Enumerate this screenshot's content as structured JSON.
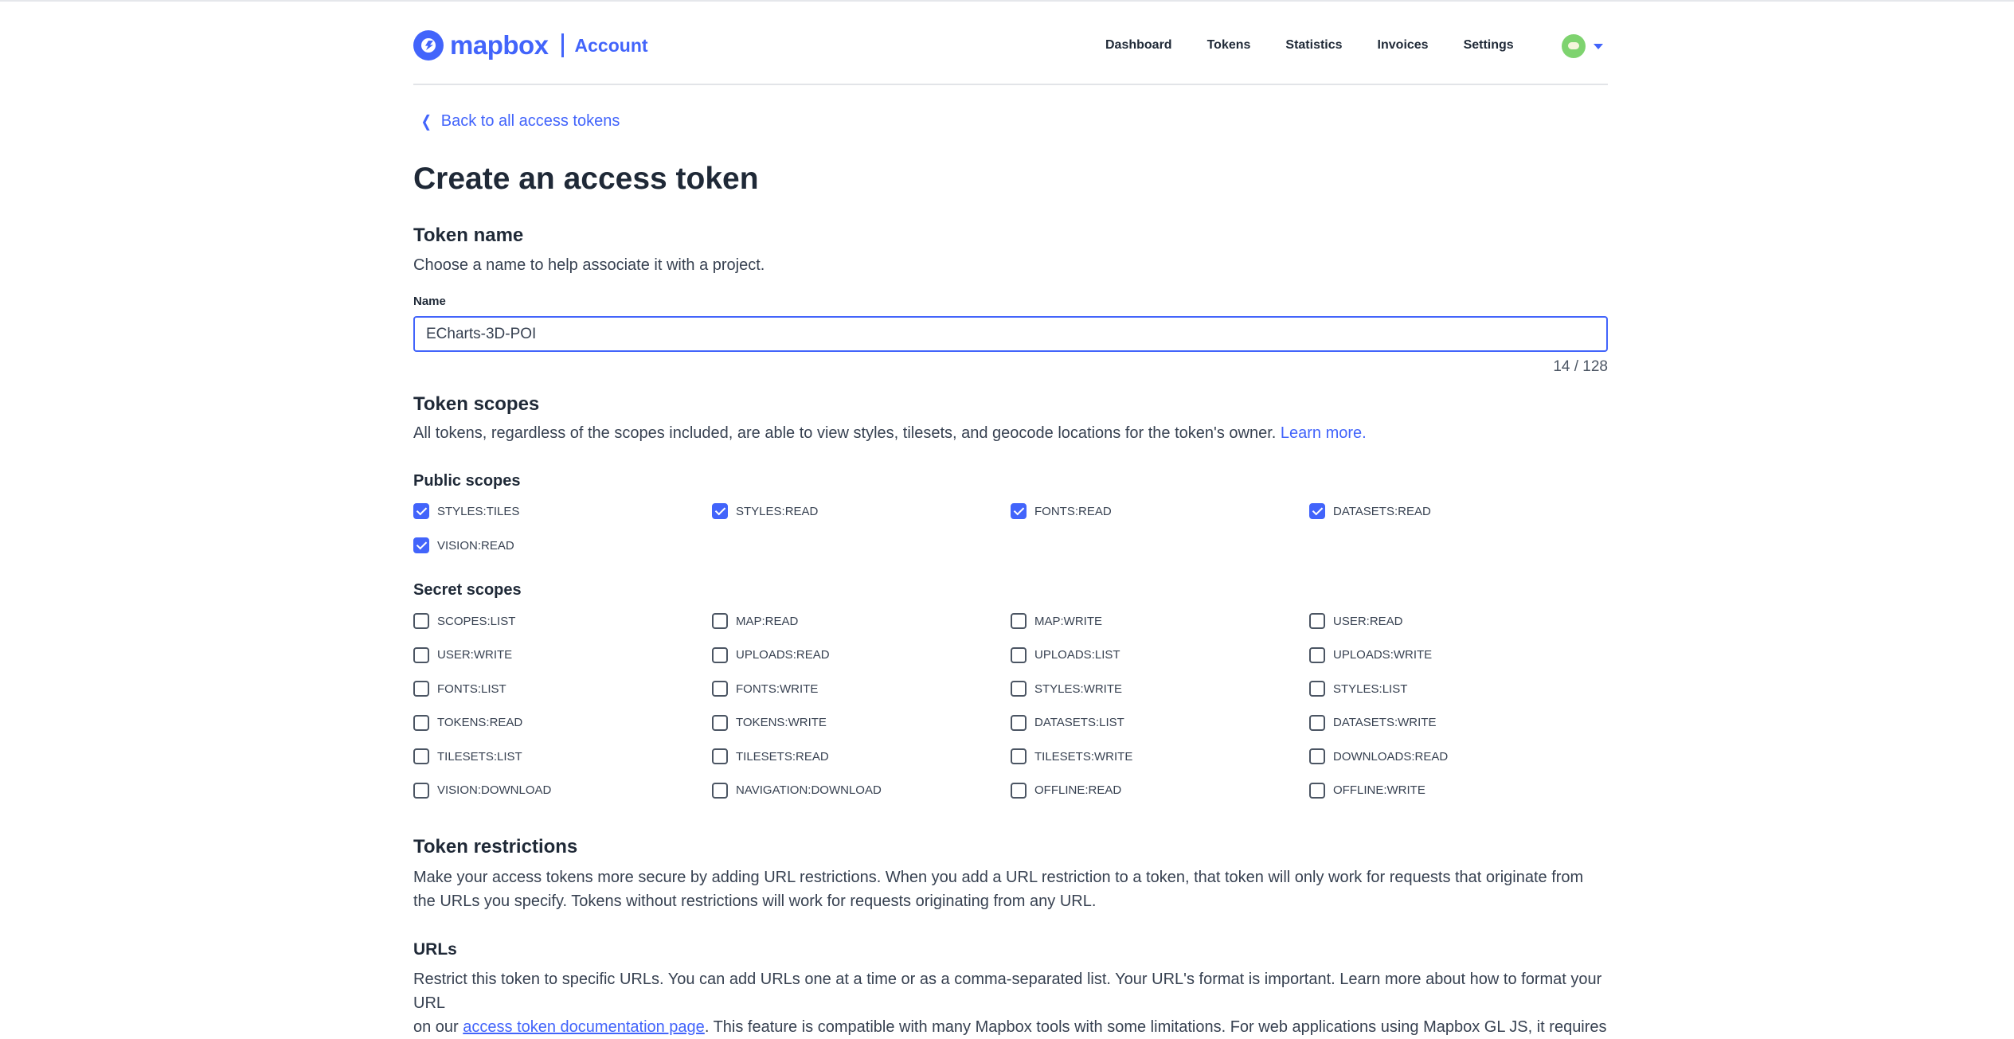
{
  "header": {
    "logo_word": "mapbox",
    "section": "Account",
    "nav": [
      "Dashboard",
      "Tokens",
      "Statistics",
      "Invoices",
      "Settings"
    ]
  },
  "back_link": "Back to all access tokens",
  "page_title": "Create an access token",
  "token_name": {
    "title": "Token name",
    "description": "Choose a name to help associate it with a project.",
    "field_label": "Name",
    "value": "ECharts-3D-POI",
    "counter": "14 / 128"
  },
  "token_scopes": {
    "title": "Token scopes",
    "description": "All tokens, regardless of the scopes included, are able to view styles, tilesets, and geocode locations for the token's owner.",
    "learn_more": "Learn more.",
    "public_title": "Public scopes",
    "public": [
      {
        "label": "STYLES:TILES",
        "checked": true
      },
      {
        "label": "STYLES:READ",
        "checked": true
      },
      {
        "label": "FONTS:READ",
        "checked": true
      },
      {
        "label": "DATASETS:READ",
        "checked": true
      },
      {
        "label": "VISION:READ",
        "checked": true
      }
    ],
    "secret_title": "Secret scopes",
    "secret": [
      {
        "label": "SCOPES:LIST",
        "checked": false
      },
      {
        "label": "MAP:READ",
        "checked": false
      },
      {
        "label": "MAP:WRITE",
        "checked": false
      },
      {
        "label": "USER:READ",
        "checked": false
      },
      {
        "label": "USER:WRITE",
        "checked": false
      },
      {
        "label": "UPLOADS:READ",
        "checked": false
      },
      {
        "label": "UPLOADS:LIST",
        "checked": false
      },
      {
        "label": "UPLOADS:WRITE",
        "checked": false
      },
      {
        "label": "FONTS:LIST",
        "checked": false
      },
      {
        "label": "FONTS:WRITE",
        "checked": false
      },
      {
        "label": "STYLES:WRITE",
        "checked": false
      },
      {
        "label": "STYLES:LIST",
        "checked": false
      },
      {
        "label": "TOKENS:READ",
        "checked": false
      },
      {
        "label": "TOKENS:WRITE",
        "checked": false
      },
      {
        "label": "DATASETS:LIST",
        "checked": false
      },
      {
        "label": "DATASETS:WRITE",
        "checked": false
      },
      {
        "label": "TILESETS:LIST",
        "checked": false
      },
      {
        "label": "TILESETS:READ",
        "checked": false
      },
      {
        "label": "TILESETS:WRITE",
        "checked": false
      },
      {
        "label": "DOWNLOADS:READ",
        "checked": false
      },
      {
        "label": "VISION:DOWNLOAD",
        "checked": false
      },
      {
        "label": "NAVIGATION:DOWNLOAD",
        "checked": false
      },
      {
        "label": "OFFLINE:READ",
        "checked": false
      },
      {
        "label": "OFFLINE:WRITE",
        "checked": false
      }
    ]
  },
  "token_restrictions": {
    "title": "Token restrictions",
    "description": "Make your access tokens more secure by adding URL restrictions. When you add a URL restriction to a token, that token will only work for requests that originate from the URLs you specify. Tokens without restrictions will work for requests originating from any URL."
  },
  "urls": {
    "title": "URLs",
    "description_1": "Restrict this token to specific URLs. You can add URLs one at a time or as a comma-separated list. Your URL's format is important. Learn more about how to format your URL",
    "description_2_prefix": "on our ",
    "description_2_link": "access token documentation page",
    "description_2_suffix": ". This feature is compatible with many Mapbox tools with some limitations. For web applications using Mapbox GL JS, it requires"
  },
  "colors": {
    "accent": "#4264fb",
    "text": "#1f2937"
  }
}
